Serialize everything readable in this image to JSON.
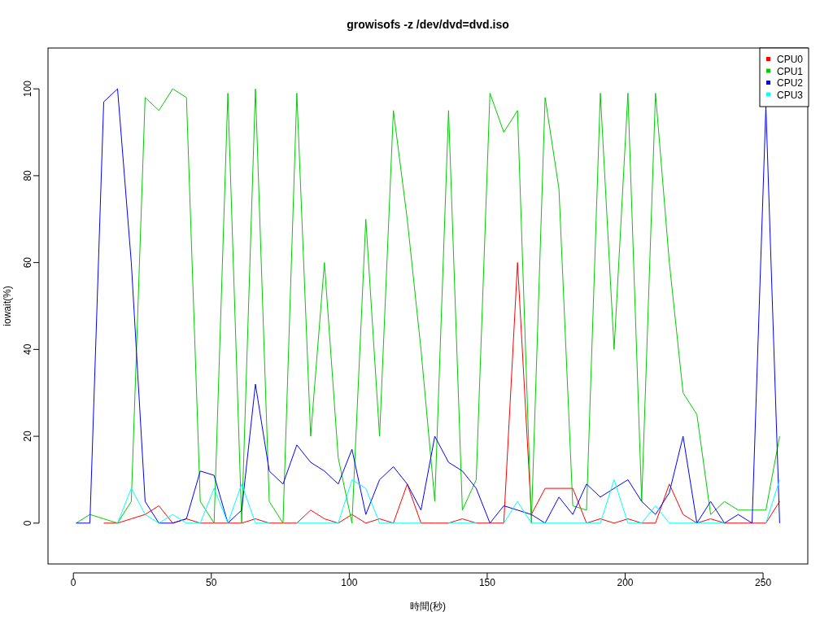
{
  "chart_data": {
    "type": "line",
    "title": "growisofs -z /dev/dvd=dvd.iso",
    "xlabel": "時間(秒)",
    "ylabel": "iowait(%)",
    "x": [
      1,
      6,
      11,
      16,
      21,
      26,
      31,
      36,
      41,
      46,
      51,
      56,
      61,
      66,
      71,
      76,
      81,
      86,
      91,
      96,
      101,
      106,
      111,
      116,
      121,
      126,
      131,
      136,
      141,
      146,
      151,
      156,
      161,
      166,
      171,
      176,
      181,
      186,
      191,
      196,
      201,
      206,
      211,
      216,
      221,
      226,
      231,
      236,
      241,
      246,
      251,
      256
    ],
    "series": [
      {
        "name": "CPU0",
        "color": "#ff0000",
        "values": [
          null,
          null,
          0,
          0,
          1,
          2,
          4,
          0,
          1,
          0,
          0,
          0,
          0,
          1,
          0,
          0,
          0,
          3,
          1,
          0,
          2,
          0,
          1,
          0,
          9,
          0,
          0,
          0,
          1,
          0,
          0,
          0,
          60,
          2,
          8,
          8,
          8,
          0,
          1,
          0,
          1,
          0,
          0,
          9,
          2,
          0,
          1,
          0,
          0,
          0,
          0,
          5
        ]
      },
      {
        "name": "CPU1",
        "color": "#00cc00",
        "values": [
          0,
          2,
          1,
          0,
          5,
          98,
          95,
          100,
          98,
          5,
          0,
          99,
          0,
          100,
          5,
          0,
          99,
          20,
          60,
          15,
          0,
          70,
          20,
          95,
          70,
          40,
          5,
          95,
          3,
          10,
          99,
          90,
          95,
          0,
          98,
          77,
          4,
          3,
          99,
          40,
          99,
          5,
          99,
          60,
          30,
          25,
          2,
          5,
          3,
          3,
          3,
          20
        ]
      },
      {
        "name": "CPU2",
        "color": "#0000ff",
        "values": [
          0,
          0,
          97,
          100,
          60,
          5,
          0,
          0,
          1,
          12,
          11,
          0,
          3,
          32,
          12,
          9,
          18,
          14,
          12,
          9,
          17,
          2,
          10,
          13,
          9,
          3,
          20,
          14,
          12,
          8,
          0,
          4,
          3,
          2,
          0,
          6,
          2,
          9,
          6,
          8,
          10,
          5,
          2,
          7,
          20,
          0,
          5,
          0,
          2,
          0,
          96,
          0
        ]
      },
      {
        "name": "CPU3",
        "color": "#00ffff",
        "values": [
          null,
          null,
          null,
          0,
          8,
          2,
          0,
          2,
          0,
          0,
          8,
          0,
          9,
          0,
          0,
          null,
          0,
          0,
          0,
          0,
          10,
          8,
          0,
          0,
          0,
          0,
          null,
          0,
          0,
          0,
          null,
          0,
          5,
          0,
          0,
          0,
          0,
          0,
          0,
          10,
          0,
          0,
          4,
          0,
          0,
          0,
          0,
          0,
          null,
          null,
          0,
          10
        ]
      }
    ],
    "legend": true,
    "xlim": [
      -9.2,
      266.2
    ],
    "ylim": [
      -9.4,
      109.4
    ],
    "xticks": [
      0,
      50,
      100,
      150,
      200,
      250
    ],
    "yticks": [
      0,
      20,
      40,
      60,
      80,
      100
    ]
  }
}
